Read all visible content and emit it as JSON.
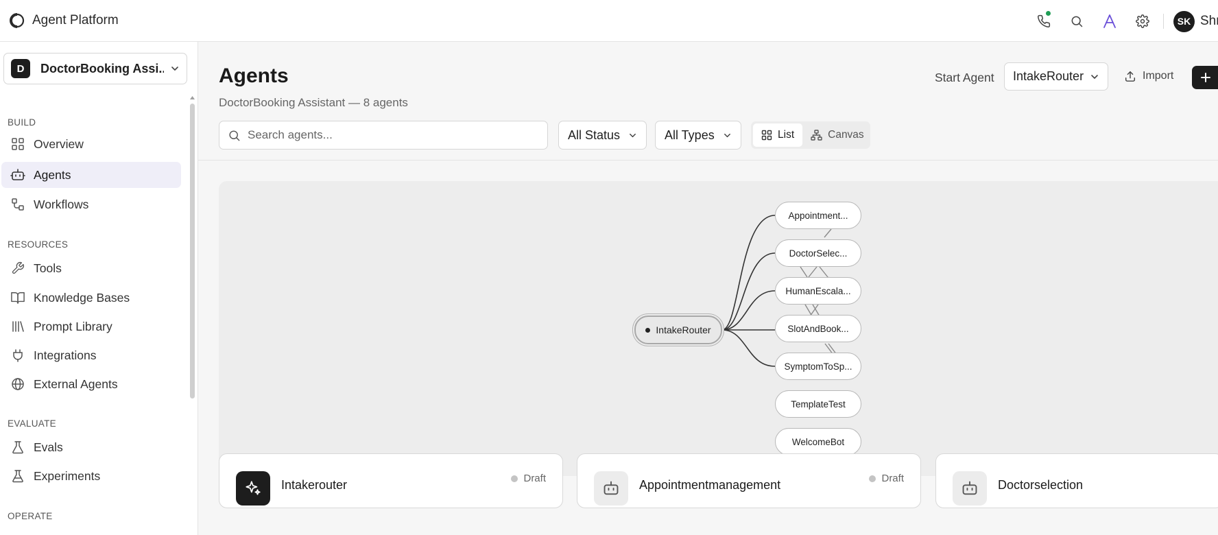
{
  "app": {
    "title": "Agent Platform"
  },
  "topbar": {
    "icons": [
      "phone-icon",
      "search-icon",
      "font-a-icon",
      "gear-icon"
    ],
    "user_initials": "SK",
    "user_name": "Shr"
  },
  "sidebar": {
    "workspace_badge": "D",
    "workspace_name": "DoctorBooking Assi...",
    "sections": {
      "build": "BUILD",
      "resources": "RESOURCES",
      "evaluate": "EVALUATE",
      "operate": "OPERATE"
    },
    "items": {
      "overview": "Overview",
      "agents": "Agents",
      "workflows": "Workflows",
      "tools": "Tools",
      "knowledge_bases": "Knowledge Bases",
      "prompt_library": "Prompt Library",
      "integrations": "Integrations",
      "external_agents": "External Agents",
      "evals": "Evals",
      "experiments": "Experiments"
    },
    "active_item": "Agents"
  },
  "header": {
    "title": "Agents",
    "subtitle": "DoctorBooking Assistant — 8 agents",
    "start_agent_label": "Start Agent",
    "start_agent_value": "IntakeRouter",
    "import_label": "Import"
  },
  "toolbar": {
    "search_placeholder": "Search agents...",
    "status_filter": "All Status",
    "type_filter": "All Types",
    "view_list": "List",
    "view_canvas": "Canvas",
    "active_view": "List"
  },
  "graph": {
    "start_node": "IntakeRouter",
    "nodes": [
      "Appointment...",
      "DoctorSelec...",
      "HumanEscala...",
      "SlotAndBook...",
      "SymptomToSp...",
      "TemplateTest",
      "WelcomeBot"
    ]
  },
  "cards": [
    {
      "title": "Intakerouter",
      "status": "Draft"
    },
    {
      "title": "Appointmentmanagement",
      "status": "Draft"
    },
    {
      "title": "Doctorselection",
      "status": ""
    }
  ],
  "colors": {
    "accent": "#6a4fd8",
    "active_nav_bg": "#efeef8",
    "online_dot": "#1f9d55",
    "dark": "#1d1d1d"
  }
}
